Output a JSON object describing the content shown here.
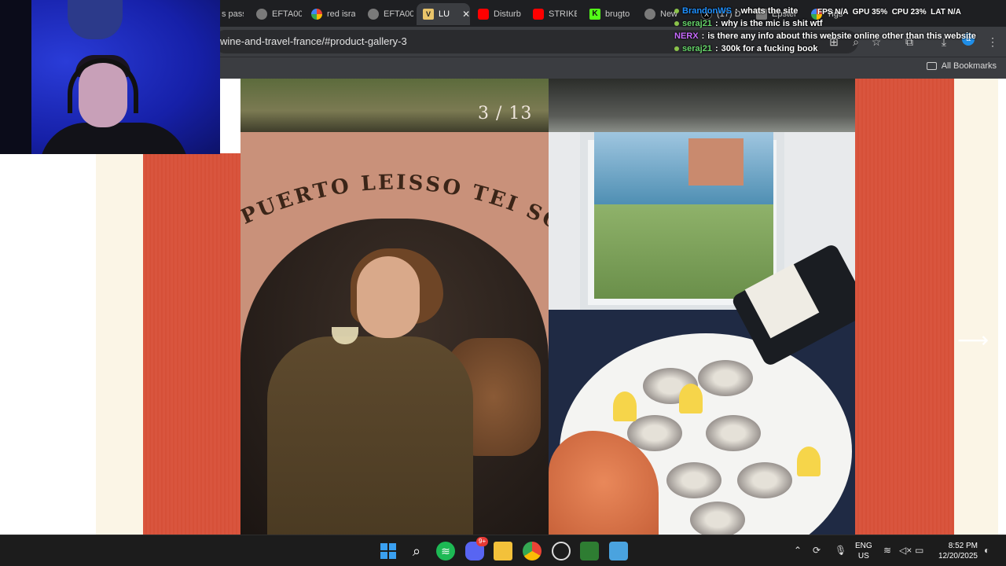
{
  "browser": {
    "tabs": [
      {
        "label": "s pass",
        "icon": "page-icon",
        "active": false
      },
      {
        "label": "EFTA00",
        "icon": "globe-icon",
        "active": false
      },
      {
        "label": "red isra",
        "icon": "google-icon",
        "active": false
      },
      {
        "label": "EFTA00",
        "icon": "globe-icon",
        "active": false
      },
      {
        "label": "LU",
        "icon": "v-logo-icon",
        "active": true
      },
      {
        "label": "Disturb",
        "icon": "youtube-icon",
        "active": false
      },
      {
        "label": "STRIKE",
        "icon": "youtube-icon",
        "active": false
      },
      {
        "label": "brugto",
        "icon": "k-logo-icon",
        "active": false
      },
      {
        "label": "New",
        "icon": "globe-icon",
        "active": false
      },
      {
        "label": "(17) D",
        "icon": "x-logo-icon",
        "active": false
      },
      {
        "label": "Epstei",
        "icon": "page-icon",
        "active": false
      },
      {
        "label": "Tigs",
        "icon": "google-icon",
        "active": false
      }
    ],
    "url": "wine-and-travel-france/#product-gallery-3",
    "bookmarks_all_label": "All Bookmarks",
    "profile_initial": "a"
  },
  "gallery": {
    "counter": "3 / 13",
    "arch_text": "PUERTO LEISSO TEI SOUCI",
    "next_arrow": "⟶"
  },
  "chat": [
    {
      "user": "BrandonWS",
      "color": "#1e90ff",
      "message": "whats the site"
    },
    {
      "user": "seraj21",
      "color": "#66d46a",
      "message": "why is the mic is shit wtf"
    },
    {
      "user": "NERX",
      "color": "#c86bff",
      "message": "is there any info about this website online other than this website"
    },
    {
      "user": "seraj21",
      "color": "#66d46a",
      "message": "300k for a fucking book"
    }
  ],
  "perf": {
    "fps_label": "FPS",
    "fps_value": "N/A",
    "gpu_label": "GPU",
    "gpu_value": "35",
    "cpu_label": "CPU",
    "cpu_value": "23",
    "lat_label": "LAT",
    "lat_value": "N/A"
  },
  "taskbar": {
    "apps": [
      "windows-start-icon",
      "search-icon",
      "spotify-icon",
      "discord-icon",
      "file-explorer-icon",
      "chrome-icon",
      "obs-icon",
      "task-manager-icon",
      "notepad-icon"
    ],
    "discord_badge": "9+",
    "lang_line1": "ENG",
    "lang_line2": "US",
    "time": "8:52 PM",
    "date": "12/20/2025"
  }
}
